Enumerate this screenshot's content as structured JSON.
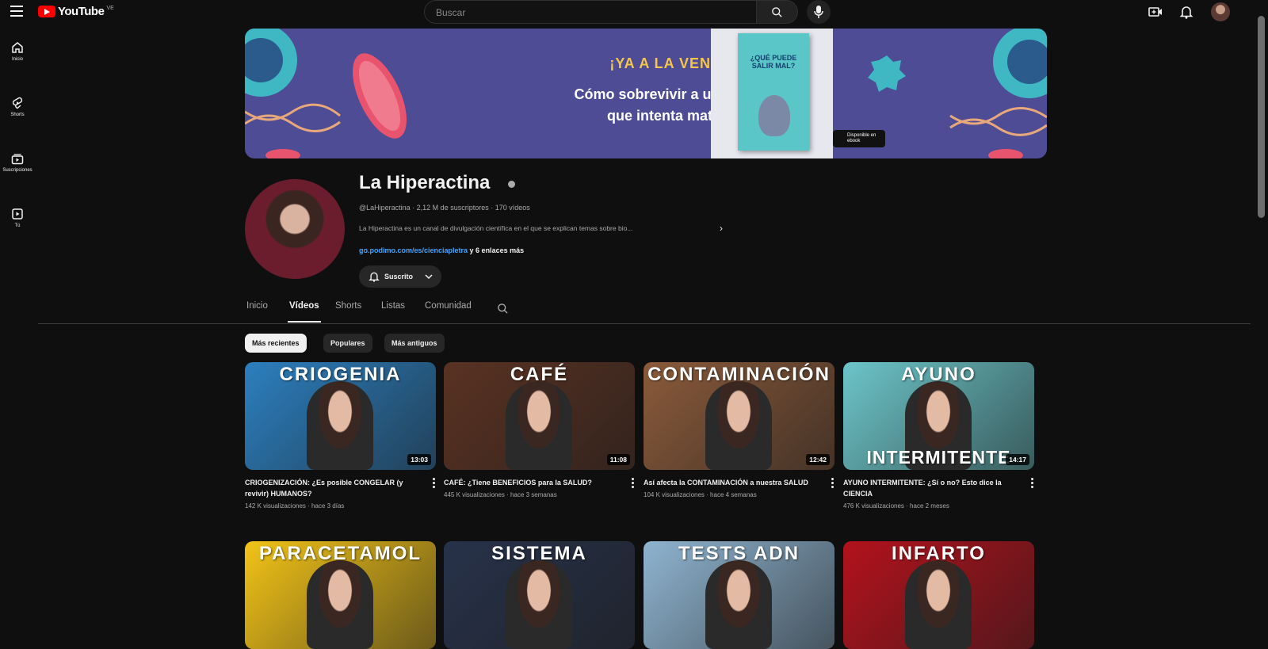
{
  "header": {
    "logo_text": "YouTube",
    "logo_country": "VE",
    "search_placeholder": "Buscar"
  },
  "sidebar": {
    "items": [
      {
        "label": "Inicio",
        "icon": "home-icon"
      },
      {
        "label": "Shorts",
        "icon": "shorts-icon"
      },
      {
        "label": "Suscripciones",
        "icon": "subscriptions-icon"
      },
      {
        "label": "Tú",
        "icon": "you-icon"
      }
    ]
  },
  "banner": {
    "headline": "¡YA A LA VENTA!",
    "subline_1": "Cómo sobrevivir a un mundo",
    "subline_2": "que intenta matarte",
    "book_title": "¿QUÉ PUEDE SALIR MAL?",
    "ebook_tag": "Disponible en ebook"
  },
  "channel": {
    "name": "La Hiperactina",
    "handle_meta": "@LaHiperactina · 2,12 M de suscriptores · 170 vídeos",
    "description": "La Hiperactina es un canal de divulgación científica en el que se explican temas sobre bio...",
    "link_url": "go.podimo.com/es/cienciapletra",
    "link_more": " y 6 enlaces más",
    "subscribe_label": "Suscrito"
  },
  "tabs": [
    {
      "label": "Inicio",
      "active": false
    },
    {
      "label": "Vídeos",
      "active": true
    },
    {
      "label": "Shorts",
      "active": false
    },
    {
      "label": "Listas",
      "active": false
    },
    {
      "label": "Comunidad",
      "active": false
    }
  ],
  "filters": [
    {
      "label": "Más recientes",
      "active": true
    },
    {
      "label": "Populares",
      "active": false
    },
    {
      "label": "Más antiguos",
      "active": false
    }
  ],
  "videos": [
    {
      "thumb_text": "CRIOGENIA",
      "duration": "13:03",
      "title": "CRIOGENIZACIÓN: ¿Es posible CONGELAR (y revivir) HUMANOS?",
      "meta": "142 K visualizaciones · hace 3 días",
      "color": "#2c7fbf"
    },
    {
      "thumb_text": "CAFÉ",
      "duration": "11:08",
      "title": "CAFÉ: ¿Tiene BENEFICIOS para la SALUD?",
      "meta": "445 K visualizaciones · hace 3 semanas",
      "color": "#5a3222"
    },
    {
      "thumb_text": "CONTAMINACIÓN",
      "duration": "12:42",
      "title": "Así afecta la CONTAMINACIÓN a nuestra SALUD",
      "meta": "104 K visualizaciones · hace 4 semanas",
      "color": "#8a5a3a"
    },
    {
      "thumb_text": "AYUNO",
      "thumb_text_bottom": "INTERMITENTE",
      "duration": "14:17",
      "title": "AYUNO INTERMITENTE: ¿Sí o no? Esto dice la CIENCIA",
      "meta": "476 K visualizaciones · hace 2 meses",
      "color": "#6cc5c9"
    },
    {
      "thumb_text": "PARACETAMOL",
      "color": "#f2c318"
    },
    {
      "thumb_text": "SISTEMA",
      "color": "#27324a"
    },
    {
      "thumb_text": "TESTS ADN",
      "color": "#8fb4d0"
    },
    {
      "thumb_text": "INFARTO",
      "color": "#b3121c"
    }
  ]
}
